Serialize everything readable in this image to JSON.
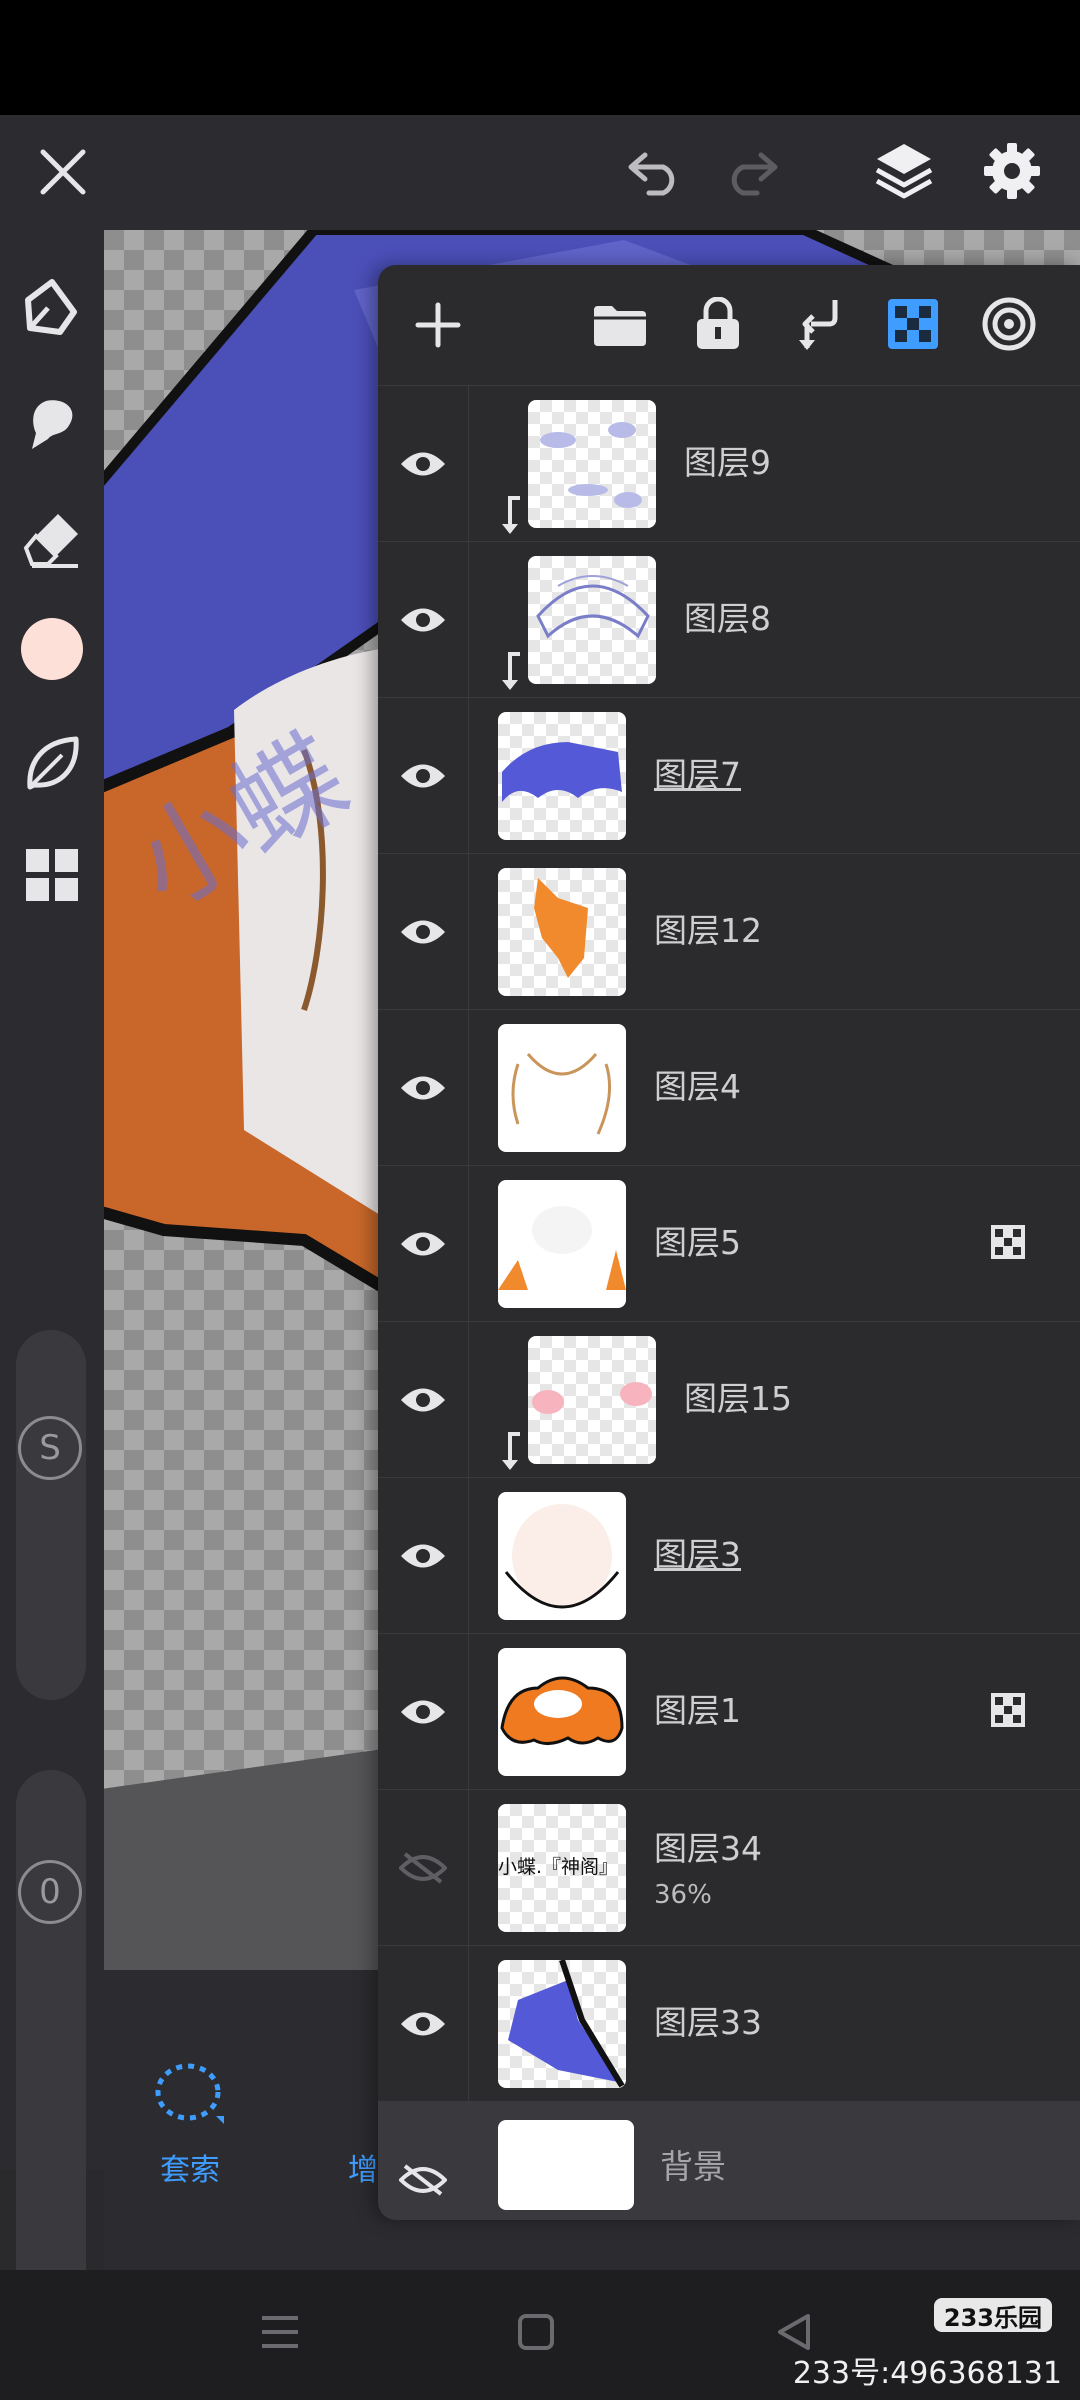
{
  "app": {
    "toolbar": {
      "close_icon": "close-icon",
      "undo_icon": "undo-icon",
      "redo_icon": "redo-icon",
      "layers_icon": "layers-icon",
      "settings_icon": "gear-icon"
    },
    "left_tools": [
      "pen-icon",
      "smudge-icon",
      "eraser-icon",
      "color-swatch",
      "leaf-brush-icon",
      "grid-icon"
    ],
    "slider_labels": {
      "size": "S",
      "opacity": "0"
    },
    "current_color": "#fde0d8",
    "accent_color": "#3f9dff"
  },
  "layer_panel": {
    "header_icons": [
      "add-layer-icon",
      "folder-icon",
      "lock-icon",
      "merge-down-icon",
      "alpha-lock-icon",
      "blend-mode-icon"
    ],
    "layers": [
      {
        "name": "图层9",
        "visible": true,
        "clipped": true,
        "underline": false,
        "alpha_lock": false
      },
      {
        "name": "图层8",
        "visible": true,
        "clipped": true,
        "underline": false,
        "alpha_lock": false
      },
      {
        "name": "图层7",
        "visible": true,
        "clipped": false,
        "underline": true,
        "alpha_lock": false
      },
      {
        "name": "图层12",
        "visible": true,
        "clipped": false,
        "underline": false,
        "alpha_lock": false
      },
      {
        "name": "图层4",
        "visible": true,
        "clipped": false,
        "underline": false,
        "alpha_lock": false
      },
      {
        "name": "图层5",
        "visible": true,
        "clipped": false,
        "underline": false,
        "alpha_lock": true
      },
      {
        "name": "图层15",
        "visible": true,
        "clipped": true,
        "underline": false,
        "alpha_lock": false
      },
      {
        "name": "图层3",
        "visible": true,
        "clipped": false,
        "underline": true,
        "alpha_lock": false
      },
      {
        "name": "图层1",
        "visible": true,
        "clipped": false,
        "underline": false,
        "alpha_lock": true
      },
      {
        "name": "图层34",
        "visible": false,
        "clipped": false,
        "underline": false,
        "alpha_lock": false,
        "opacity": "36%",
        "thumb_text": "小蝶.『神阁』"
      },
      {
        "name": "图层33",
        "visible": true,
        "clipped": false,
        "underline": false,
        "alpha_lock": false
      },
      {
        "name": "背景",
        "visible": false,
        "clipped": false,
        "underline": false,
        "alpha_lock": false
      }
    ]
  },
  "bottom_tools": {
    "lasso_label": "套索",
    "second_label": "增"
  },
  "watermark": {
    "logo": "233乐园",
    "id_text": "233号:496368131"
  }
}
